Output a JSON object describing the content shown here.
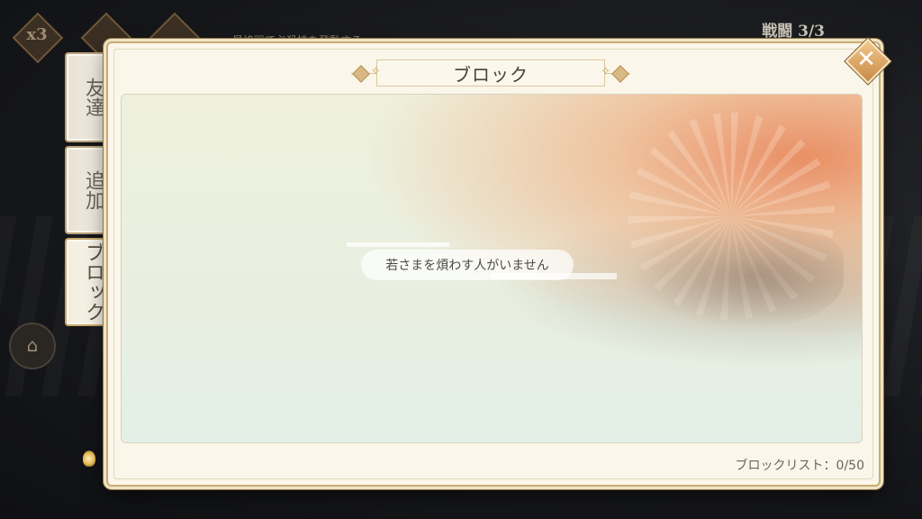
{
  "hud": {
    "speed": "x3",
    "objective": "最終戦で必殺技を発動する",
    "battle": "戦闘 3/3"
  },
  "tabs": [
    {
      "label": "友達",
      "active": false
    },
    {
      "label": "追加",
      "active": false
    },
    {
      "label": "ブロック",
      "active": true
    }
  ],
  "dialog": {
    "title": "ブロック",
    "empty_message": "若さまを煩わす人がいません",
    "block_list_label": "ブロックリスト：0/50",
    "close_icon": "close-icon"
  },
  "colors": {
    "panel_bg": "#faf6ea",
    "gold_border": "#c9ab72",
    "close_button": "#d9a462",
    "text": "#4b4136"
  }
}
